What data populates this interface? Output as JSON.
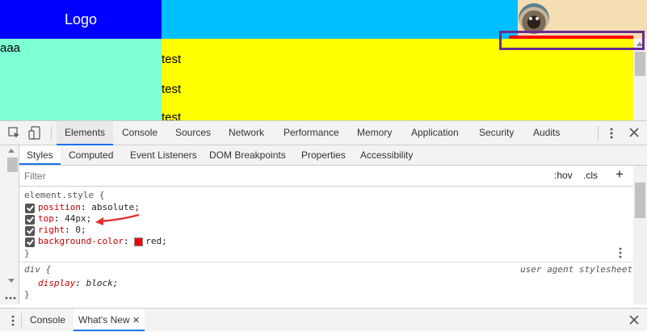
{
  "page": {
    "logo": "Logo",
    "left_text": "aaa",
    "main_lines": [
      "test",
      "test",
      "test"
    ]
  },
  "devtools": {
    "tabs": [
      "Elements",
      "Console",
      "Sources",
      "Network",
      "Performance",
      "Memory",
      "Application",
      "Security",
      "Audits"
    ],
    "subtabs": [
      "Styles",
      "Computed",
      "Event Listeners",
      "DOM Breakpoints",
      "Properties",
      "Accessibility"
    ],
    "filter_placeholder": "Filter",
    "hov": ":hov",
    "cls": ".cls",
    "plus": "+",
    "rules": {
      "element_selector": "element.style {",
      "props": [
        {
          "name": "position",
          "value": "absolute;"
        },
        {
          "name": "top",
          "value": "44px;"
        },
        {
          "name": "right",
          "value": "0;"
        },
        {
          "name": "background-color",
          "value": "red;"
        }
      ],
      "close_brace": "}",
      "div_selector": "div {",
      "ua_label": "user agent stylesheet",
      "div_prop": {
        "name": "display",
        "value": "block;"
      }
    },
    "drawer_tabs": [
      "Console",
      "What's New"
    ],
    "colors": {
      "accent": "#1a73e8",
      "prop_name": "#c80000",
      "swatch": "#ff0000"
    }
  }
}
